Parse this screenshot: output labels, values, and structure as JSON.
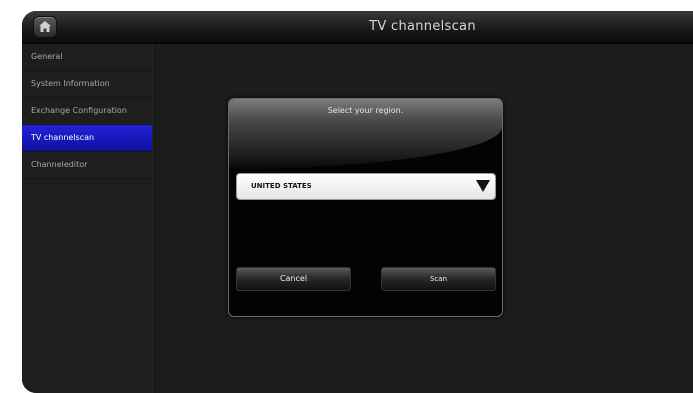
{
  "window": {
    "title": "TV channelscan"
  },
  "sidebar": {
    "items": [
      {
        "label": "General",
        "active": false
      },
      {
        "label": "System Information",
        "active": false
      },
      {
        "label": "Exchange Configuration",
        "active": false
      },
      {
        "label": "TV channelscan",
        "active": true
      },
      {
        "label": "Channeleditor",
        "active": false
      }
    ]
  },
  "dialog": {
    "title": "Select your region.",
    "region_select": {
      "value": "UNITED STATES"
    },
    "cancel_label": "Cancel",
    "scan_label": "Scan"
  },
  "icons": {
    "home": "home-icon",
    "dropdown": "triangle-down-icon"
  },
  "colors": {
    "active": "#1818c8",
    "background": "#1c1c1c"
  }
}
